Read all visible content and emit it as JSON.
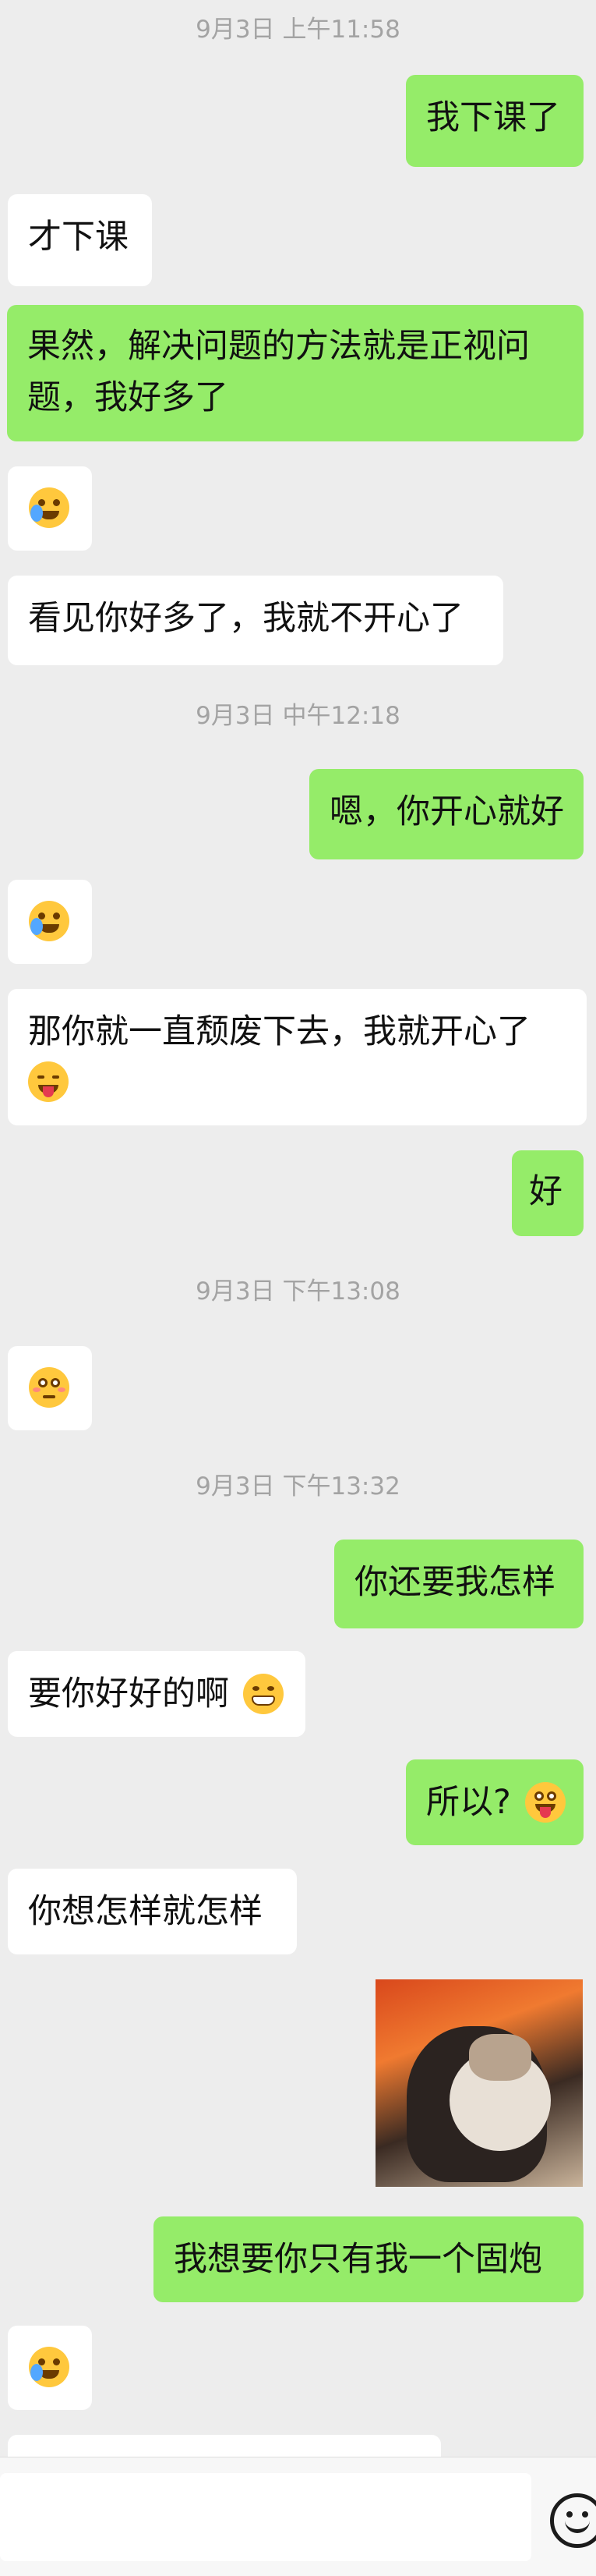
{
  "timestamps": [
    "9月3日 上午11:58",
    "9月3日 中午12:18",
    "9月3日 下午13:08",
    "9月3日 下午13:32"
  ],
  "messages": [
    {
      "sender": "me",
      "text": "我下课了"
    },
    {
      "sender": "them",
      "text": "才下课"
    },
    {
      "sender": "me",
      "lines": [
        "果然，解决问题的方法就是正视问",
        "题，我好多了"
      ]
    },
    {
      "sender": "them",
      "emoji": "face-with-tears-of-joy"
    },
    {
      "sender": "them",
      "text": "看见你好多了，我就不开心了"
    },
    {
      "sender": "me",
      "text": "嗯，你开心就好"
    },
    {
      "sender": "them",
      "emoji": "face-with-tears-of-joy"
    },
    {
      "sender": "them",
      "lines": [
        "那你就一直颓废下去，我就开心了",
        ""
      ],
      "emoji": "squinting-face-with-tongue"
    },
    {
      "sender": "me",
      "text": "好"
    },
    {
      "sender": "them",
      "emoji": "pleading-face"
    },
    {
      "sender": "me",
      "text": "你还要我怎样"
    },
    {
      "sender": "them",
      "text": "要你好好的啊",
      "emoji": "grinning-face"
    },
    {
      "sender": "me",
      "text": "所以?",
      "emoji": "face-with-tongue"
    },
    {
      "sender": "them",
      "text": "你想怎样就怎样"
    },
    {
      "sender": "me",
      "sticker": "cat-facepalm-sticker"
    },
    {
      "sender": "me",
      "text": "我想要你只有我一个固炮"
    },
    {
      "sender": "them",
      "emoji": "face-with-tears-of-joy"
    }
  ],
  "composer": {
    "value": "",
    "emoji_icon": "emoji-smile-icon"
  },
  "colors": {
    "background": "#ededed",
    "my_bubble": "#95ec69",
    "their_bubble": "#ffffff",
    "timestamp": "#a3a3a3"
  }
}
